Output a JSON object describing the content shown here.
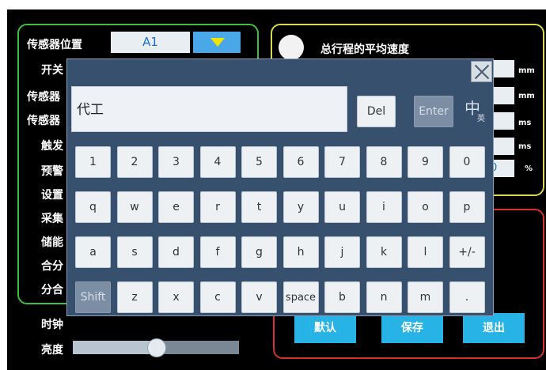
{
  "left_panel": {
    "sensor_position_label": "传感器位置",
    "sensor_position_value": "A1",
    "row_labels": [
      "开关",
      "传感器",
      "传感器",
      "触发",
      "预警",
      "设置",
      "采集",
      "储能",
      "合分",
      "分合",
      "时钟",
      "亮度"
    ],
    "brightness_level": 0.5
  },
  "right_top": {
    "radio_label": "总行程的平均速度",
    "units": [
      "mm",
      "mm",
      "ms",
      "ms",
      "%"
    ],
    "partial_value": "0"
  },
  "right_bottom": {
    "buttons": [
      "默认",
      "保存",
      "退出"
    ]
  },
  "keyboard": {
    "input_value": "代工",
    "del_label": "Del",
    "enter_label": "Enter",
    "lang_main": "中",
    "lang_sub": "英",
    "rows": [
      [
        "1",
        "2",
        "3",
        "4",
        "5",
        "6",
        "7",
        "8",
        "9",
        "0"
      ],
      [
        "q",
        "w",
        "e",
        "r",
        "t",
        "y",
        "u",
        "i",
        "o",
        "p"
      ],
      [
        "a",
        "s",
        "d",
        "f",
        "g",
        "h",
        "j",
        "k",
        "l",
        "+/-"
      ],
      [
        "Shift",
        "z",
        "x",
        "c",
        "v",
        "space",
        "b",
        "n",
        "m",
        "."
      ]
    ]
  },
  "colors": {
    "panel_green": "#3fbf3f",
    "panel_yellow": "#d8d84a",
    "panel_red": "#d93030",
    "keyboard_bg": "#37506d",
    "accent_blue": "#27b3e6"
  }
}
